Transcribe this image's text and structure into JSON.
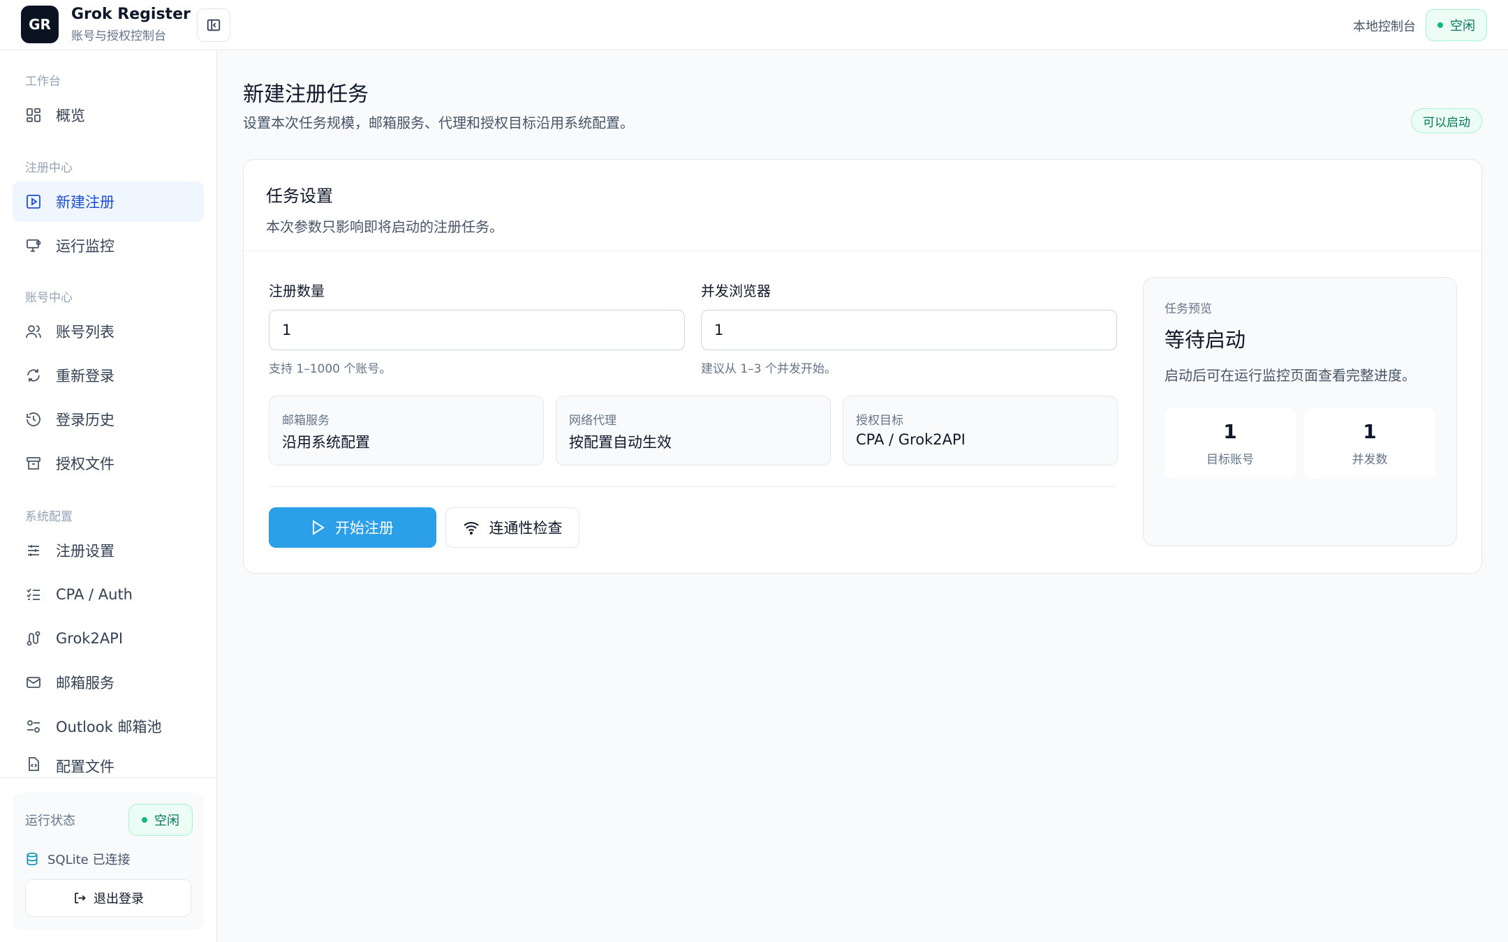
{
  "header": {
    "logo_text": "GR",
    "title": "Grok Register",
    "subtitle": "账号与授权控制台",
    "local_console": "本地控制台",
    "status": "空闲"
  },
  "sidebar": {
    "sections": [
      {
        "label": "工作台"
      },
      {
        "label": "注册中心"
      },
      {
        "label": "账号中心"
      },
      {
        "label": "系统配置"
      }
    ],
    "items": [
      {
        "label": "概览",
        "icon": "grid-icon"
      },
      {
        "label": "新建注册",
        "icon": "play-square-icon",
        "active": true
      },
      {
        "label": "运行监控",
        "icon": "monitor-icon"
      },
      {
        "label": "账号列表",
        "icon": "users-icon"
      },
      {
        "label": "重新登录",
        "icon": "refresh-icon"
      },
      {
        "label": "登录历史",
        "icon": "history-icon"
      },
      {
        "label": "授权文件",
        "icon": "archive-icon"
      },
      {
        "label": "注册设置",
        "icon": "sliders-icon"
      },
      {
        "label": "CPA / Auth",
        "icon": "checklist-icon"
      },
      {
        "label": "Grok2API",
        "icon": "route-icon"
      },
      {
        "label": "邮箱服务",
        "icon": "mail-icon"
      },
      {
        "label": "Outlook 邮箱池",
        "icon": "settings-toggles-icon"
      },
      {
        "label": "配置文件",
        "icon": "file-code-icon"
      }
    ],
    "status_card": {
      "label": "运行状态",
      "status": "空闲",
      "db": "SQLite 已连接",
      "logout": "退出登录"
    }
  },
  "main": {
    "title": "新建注册任务",
    "subtitle": "设置本次任务规模，邮箱服务、代理和授权目标沿用系统配置。",
    "ready_badge": "可以启动",
    "card": {
      "title": "任务设置",
      "subtitle": "本次参数只影响即将启动的注册任务。",
      "count_label": "注册数量",
      "count_value": "1",
      "count_hint": "支持 1–1000 个账号。",
      "concurrency_label": "并发浏览器",
      "concurrency_value": "1",
      "concurrency_hint": "建议从 1–3 个并发开始。",
      "info": [
        {
          "label": "邮箱服务",
          "value": "沿用系统配置"
        },
        {
          "label": "网络代理",
          "value": "按配置自动生效"
        },
        {
          "label": "授权目标",
          "value": "CPA / Grok2API"
        }
      ],
      "start_label": "开始注册",
      "check_label": "连通性检查"
    },
    "preview": {
      "label": "任务预览",
      "title": "等待启动",
      "subtitle": "启动后可在运行监控页面查看完整进度。",
      "stats": [
        {
          "value": "1",
          "label": "目标账号"
        },
        {
          "value": "1",
          "label": "并发数"
        }
      ]
    }
  },
  "colors": {
    "accent": "#2b9fe8",
    "active_nav": "#1d4ed8",
    "success": "#047857"
  }
}
